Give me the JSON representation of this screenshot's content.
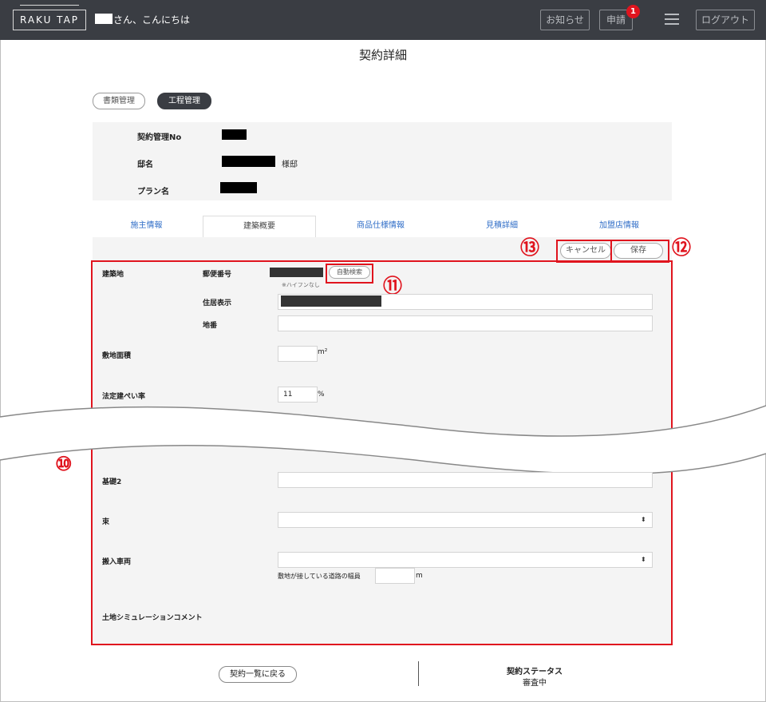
{
  "header": {
    "logo": "RAKU TAP",
    "greeting": "さん、こんにちは",
    "notice_label": "お知らせ",
    "request_label": "申請",
    "request_badge": "1",
    "logout_label": "ログアウト"
  },
  "page_title": "契約詳細",
  "top_tabs": {
    "documents": "書類管理",
    "process": "工程管理"
  },
  "info": {
    "contract_no_label": "契約管理No",
    "house_name_label": "邸名",
    "house_suffix": "様邸",
    "plan_name_label": "プラン名"
  },
  "tabs": [
    "施主情報",
    "建築概要",
    "商品仕様情報",
    "見積詳細",
    "加盟店情報"
  ],
  "actions": {
    "cancel": "キャンセル",
    "save": "保存"
  },
  "annotations": {
    "n10": "⑩",
    "n11": "⑪",
    "n12": "⑫",
    "n13": "⑬"
  },
  "form": {
    "site_label": "建築地",
    "postal_label": "郵便番号",
    "auto_search": "自動検索",
    "no_hyphen": "※ハイフンなし",
    "address_label": "住居表示",
    "lot_label": "地番",
    "area_label": "敷地面積",
    "area_unit": "m²",
    "coverage_label": "法定建ぺい率",
    "coverage_value": "11",
    "coverage_unit": "%",
    "foundation2_label": "基礎2",
    "bundle_label": "束",
    "vehicle_label": "搬入車両",
    "road_width_label": "敷地が接している道路の幅員",
    "road_width_unit": "m",
    "land_comment_label": "土地シミュレーションコメント"
  },
  "footer": {
    "back_button": "契約一覧に戻る",
    "status_label": "契約ステータス",
    "status_value": "審査中"
  },
  "colors": {
    "header_bg": "#3a3d43",
    "annotation_red": "#e0141e",
    "link_blue": "#2f6dc7"
  }
}
